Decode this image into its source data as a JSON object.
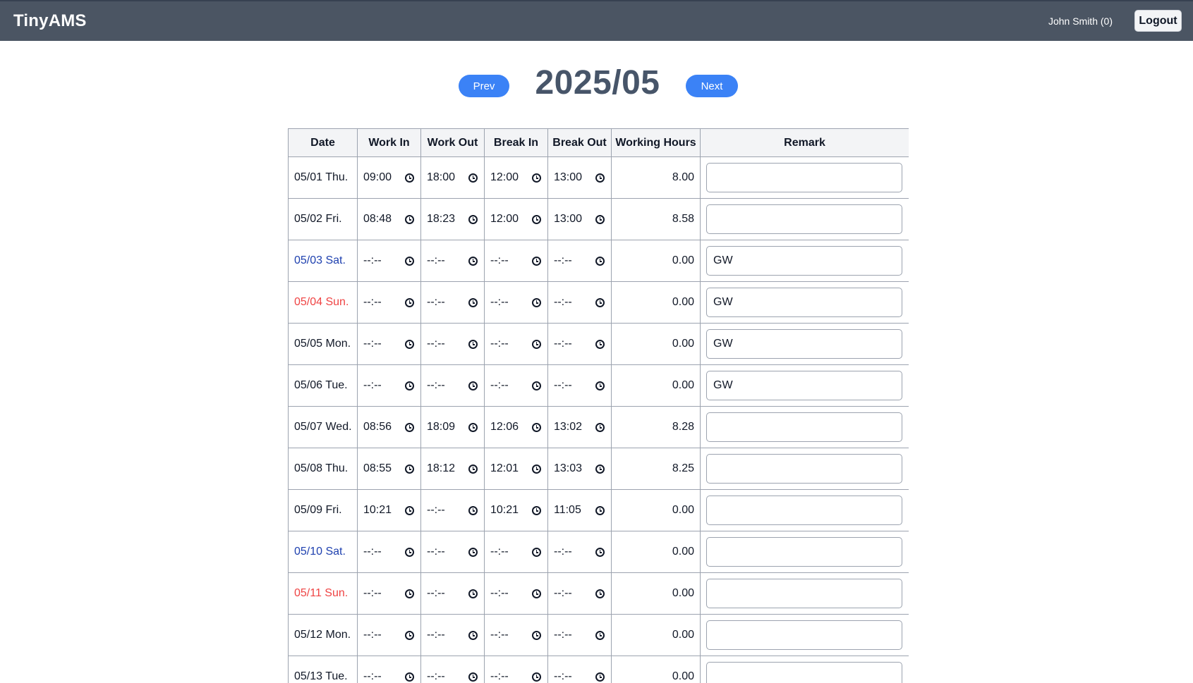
{
  "app": {
    "brand": "TinyAMS",
    "user_label": "John Smith (0)",
    "logout_label": "Logout"
  },
  "month_nav": {
    "prev_label": "Prev",
    "title": "2025/05",
    "next_label": "Next"
  },
  "table": {
    "headers": [
      "Date",
      "Work In",
      "Work Out",
      "Break In",
      "Break Out",
      "Working Hours",
      "Remark"
    ],
    "rows": [
      {
        "date": "05/01 Thu.",
        "day_type": "weekday",
        "work_in": "09:00",
        "work_out": "18:00",
        "break_in": "12:00",
        "break_out": "13:00",
        "hours": "8.00",
        "remark": ""
      },
      {
        "date": "05/02 Fri.",
        "day_type": "weekday",
        "work_in": "08:48",
        "work_out": "18:23",
        "break_in": "12:00",
        "break_out": "13:00",
        "hours": "8.58",
        "remark": ""
      },
      {
        "date": "05/03 Sat.",
        "day_type": "saturday",
        "work_in": "--:--",
        "work_out": "--:--",
        "break_in": "--:--",
        "break_out": "--:--",
        "hours": "0.00",
        "remark": "GW"
      },
      {
        "date": "05/04 Sun.",
        "day_type": "sunday",
        "work_in": "--:--",
        "work_out": "--:--",
        "break_in": "--:--",
        "break_out": "--:--",
        "hours": "0.00",
        "remark": "GW"
      },
      {
        "date": "05/05 Mon.",
        "day_type": "weekday",
        "work_in": "--:--",
        "work_out": "--:--",
        "break_in": "--:--",
        "break_out": "--:--",
        "hours": "0.00",
        "remark": "GW"
      },
      {
        "date": "05/06 Tue.",
        "day_type": "weekday",
        "work_in": "--:--",
        "work_out": "--:--",
        "break_in": "--:--",
        "break_out": "--:--",
        "hours": "0.00",
        "remark": "GW"
      },
      {
        "date": "05/07 Wed.",
        "day_type": "weekday",
        "work_in": "08:56",
        "work_out": "18:09",
        "break_in": "12:06",
        "break_out": "13:02",
        "hours": "8.28",
        "remark": ""
      },
      {
        "date": "05/08 Thu.",
        "day_type": "weekday",
        "work_in": "08:55",
        "work_out": "18:12",
        "break_in": "12:01",
        "break_out": "13:03",
        "hours": "8.25",
        "remark": ""
      },
      {
        "date": "05/09 Fri.",
        "day_type": "weekday",
        "work_in": "10:21",
        "work_out": "--:--",
        "break_in": "10:21",
        "break_out": "11:05",
        "hours": "0.00",
        "remark": ""
      },
      {
        "date": "05/10 Sat.",
        "day_type": "saturday",
        "work_in": "--:--",
        "work_out": "--:--",
        "break_in": "--:--",
        "break_out": "--:--",
        "hours": "0.00",
        "remark": ""
      },
      {
        "date": "05/11 Sun.",
        "day_type": "sunday",
        "work_in": "--:--",
        "work_out": "--:--",
        "break_in": "--:--",
        "break_out": "--:--",
        "hours": "0.00",
        "remark": ""
      },
      {
        "date": "05/12 Mon.",
        "day_type": "weekday",
        "work_in": "--:--",
        "work_out": "--:--",
        "break_in": "--:--",
        "break_out": "--:--",
        "hours": "0.00",
        "remark": ""
      },
      {
        "date": "05/13 Tue.",
        "day_type": "weekday",
        "work_in": "--:--",
        "work_out": "--:--",
        "break_in": "--:--",
        "break_out": "--:--",
        "hours": "0.00",
        "remark": ""
      }
    ]
  },
  "colors": {
    "navbar": "#4b5563",
    "accent": "#3b82f6",
    "saturday": "#1e40af",
    "sunday": "#ef4444"
  },
  "icons": {
    "time_picker": "clock-icon"
  }
}
